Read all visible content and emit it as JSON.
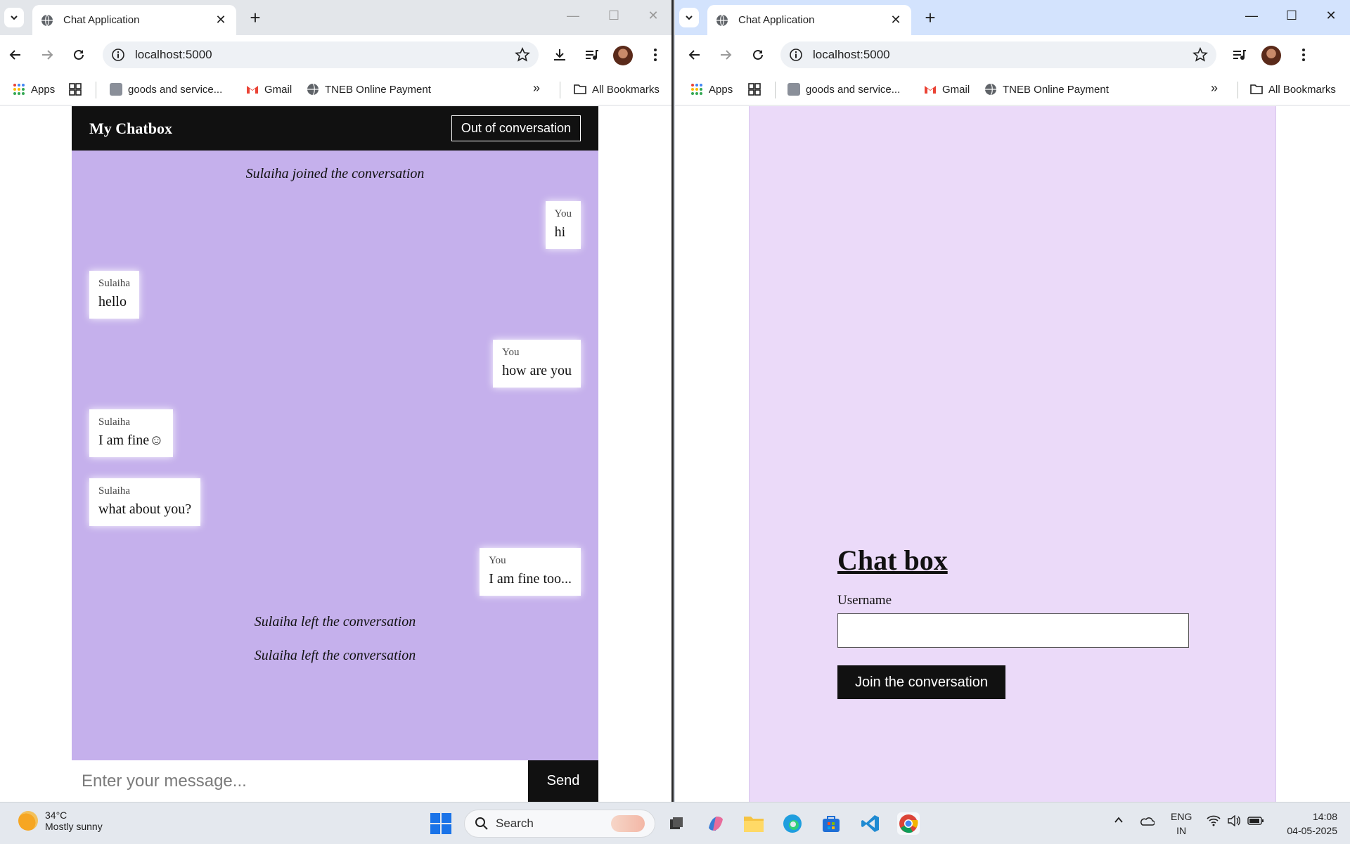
{
  "browser": {
    "tab_title": "Chat Application",
    "url": "localhost:5000",
    "bookmarks": {
      "apps": "Apps",
      "goods": "goods and service...",
      "gmail": "Gmail",
      "tneb": "TNEB Online Payment",
      "more": "»",
      "all": "All Bookmarks"
    }
  },
  "chat": {
    "title": "My Chatbox",
    "exit_label": "Out of conversation",
    "messages": [
      {
        "type": "system",
        "text": "Sulaiha joined the conversation"
      },
      {
        "type": "me",
        "sender": "You",
        "text": "hi"
      },
      {
        "type": "them",
        "sender": "Sulaiha",
        "text": "hello"
      },
      {
        "type": "me",
        "sender": "You",
        "text": "how are you"
      },
      {
        "type": "them",
        "sender": "Sulaiha",
        "text": "I am fine☺"
      },
      {
        "type": "them",
        "sender": "Sulaiha",
        "text": "what about you?"
      },
      {
        "type": "me",
        "sender": "You",
        "text": "I am fine too..."
      },
      {
        "type": "system",
        "text": "Sulaiha left the conversation"
      },
      {
        "type": "system",
        "text": "Sulaiha left the conversation"
      }
    ],
    "input_placeholder": "Enter your message...",
    "send_label": "Send"
  },
  "login": {
    "title": "Chat box",
    "username_label": "Username",
    "username_value": "",
    "join_label": "Join the conversation"
  },
  "taskbar": {
    "temperature": "34°C",
    "weather": "Mostly sunny",
    "search_placeholder": "Search",
    "lang_top": "ENG",
    "lang_bottom": "IN",
    "time": "14:08",
    "date": "04-05-2025"
  },
  "colors": {
    "chat_bg": "#c5b0ec",
    "login_bg": "#ebdaf9",
    "header_bg": "#111111"
  }
}
